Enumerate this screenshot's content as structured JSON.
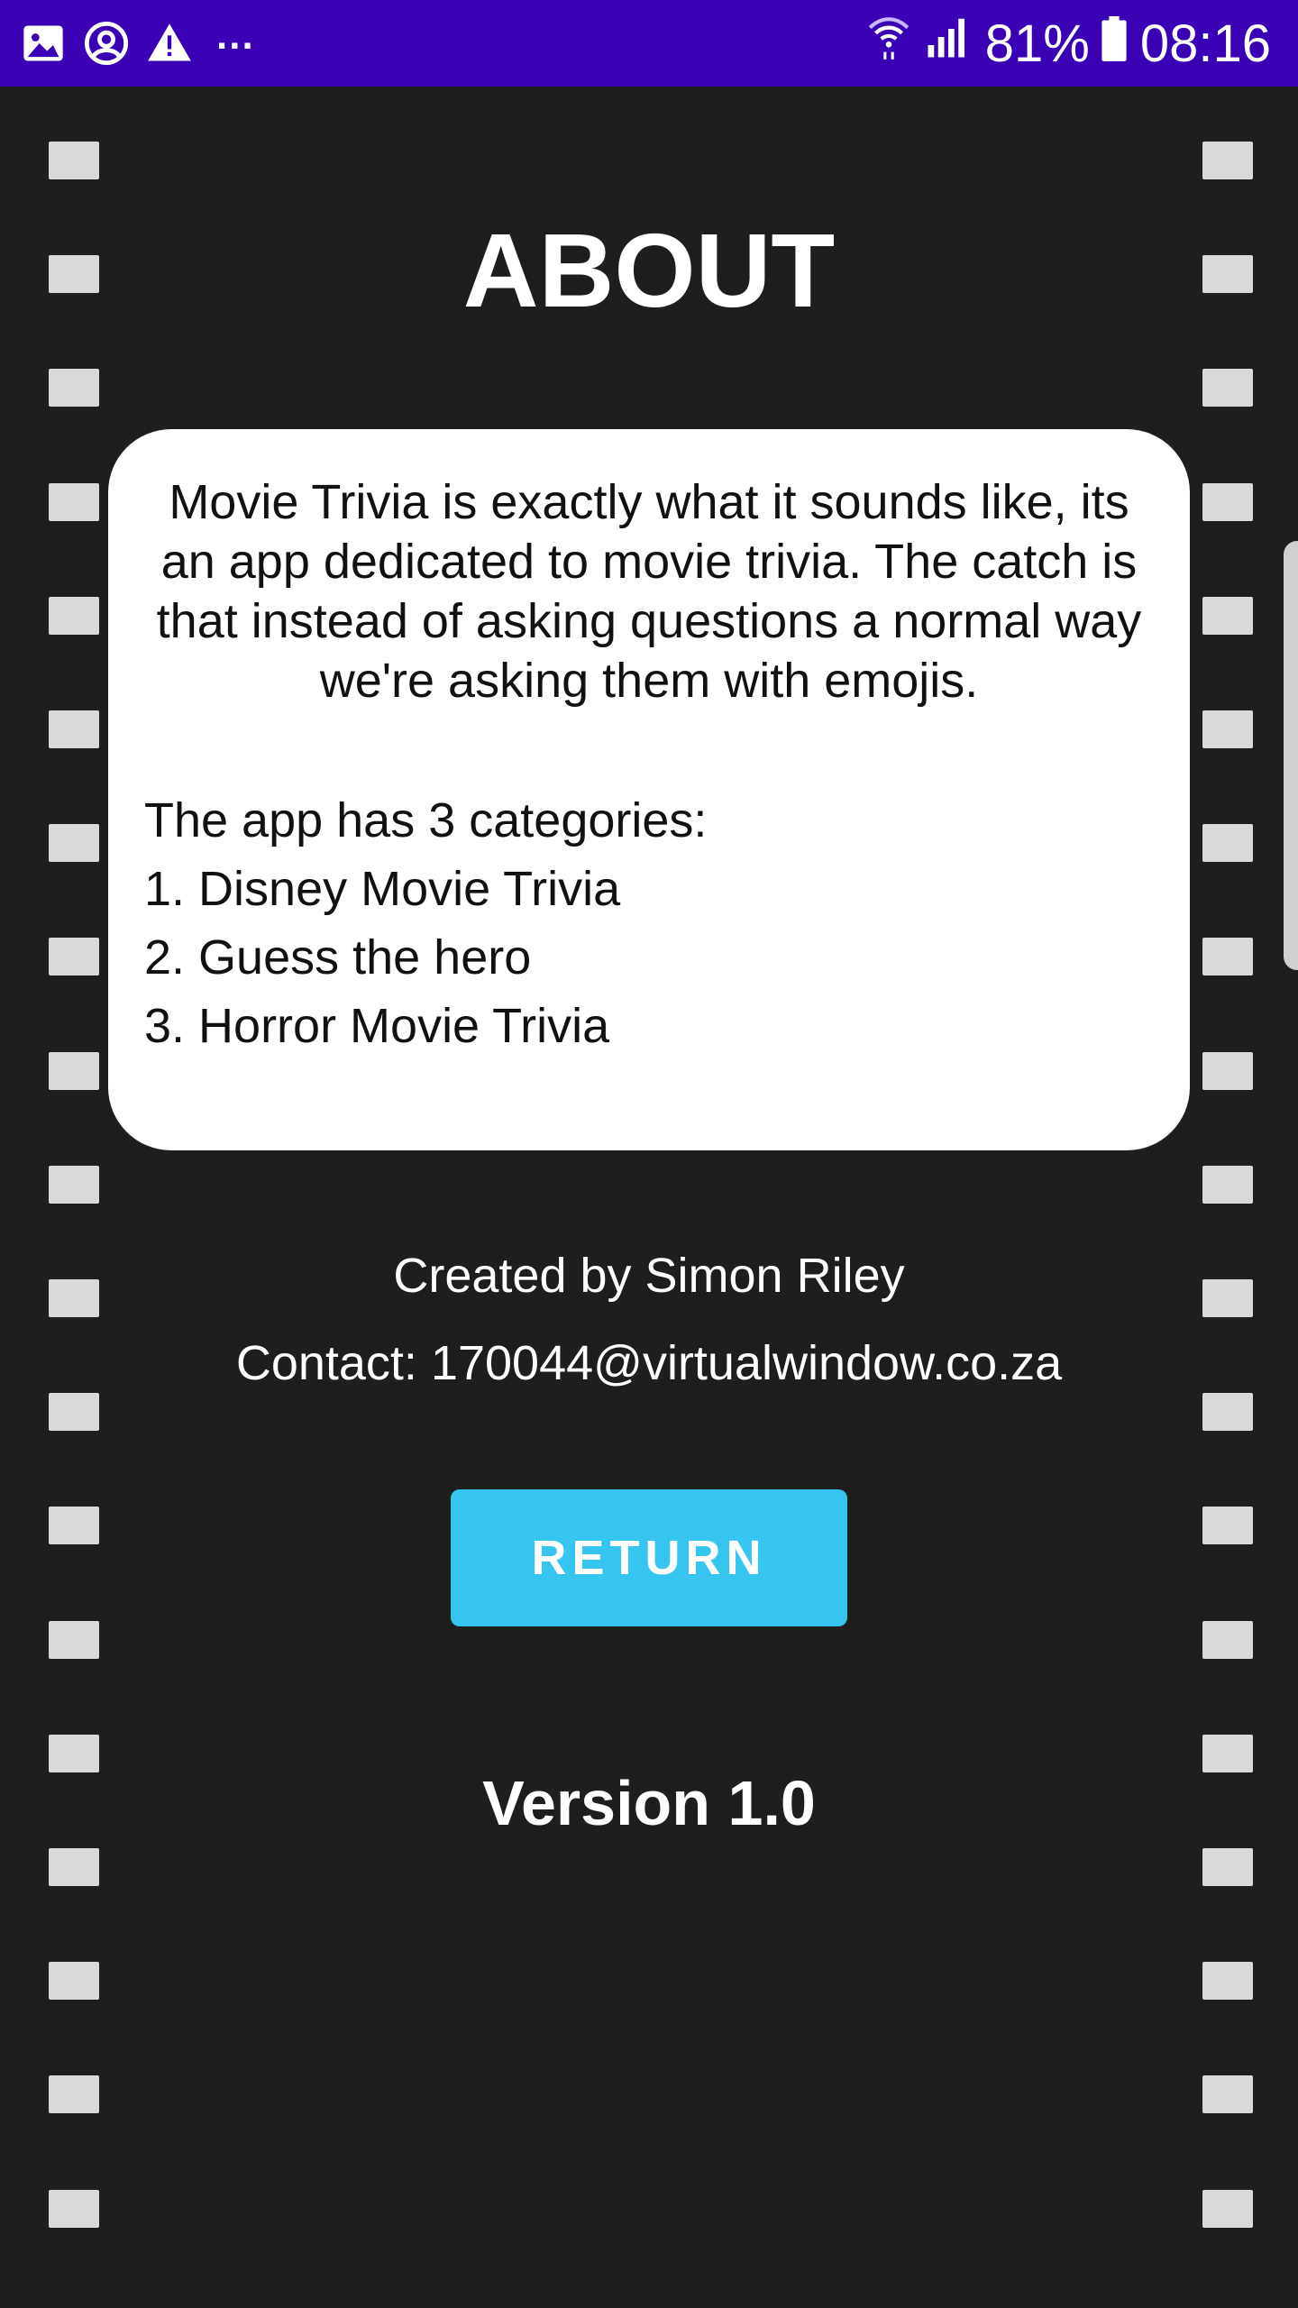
{
  "status_bar": {
    "left_icons": [
      "image-icon",
      "account-circle-icon",
      "warning-icon"
    ],
    "more": "...",
    "battery_percent": "81%",
    "time": "08:16",
    "background_color": "#3a00b3"
  },
  "screen": {
    "title": "ABOUT",
    "description": "Movie Trivia is exactly what it sounds like, its an app dedicated to movie trivia. The catch is that instead of asking questions a normal way we're asking them with emojis.",
    "categories_heading": "The app has 3 categories:",
    "categories": [
      "1. Disney Movie Trivia",
      "2. Guess the hero",
      "3. Horror Movie Trivia"
    ],
    "created_by": "Created by Simon Riley",
    "contact": "Contact: 170044@virtualwindow.co.za",
    "return_label": "RETURN",
    "version": "Version 1.0"
  },
  "colors": {
    "background": "#1e1e1e",
    "button": "#36c5ee",
    "sprocket": "#d9d9d9"
  }
}
